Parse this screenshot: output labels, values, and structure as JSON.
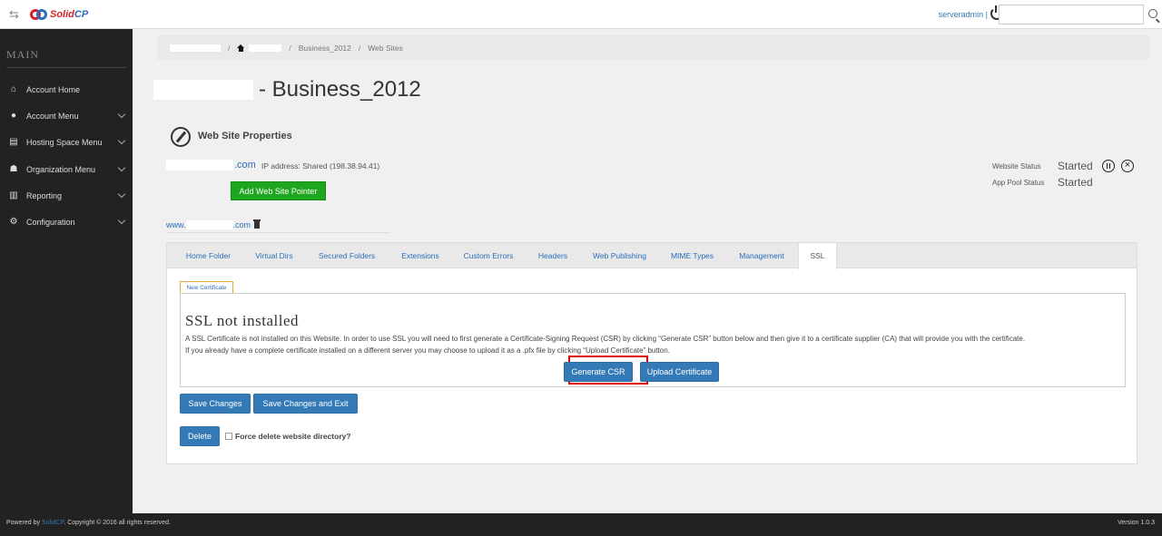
{
  "header": {
    "logo_solid": "Solid",
    "logo_cp": "CP",
    "user": "serveradmin |",
    "search_placeholder": ""
  },
  "sidebar": {
    "section_label": "MAIN",
    "items": [
      {
        "label": "Account Home",
        "icon": "home-icon"
      },
      {
        "label": "Account Menu",
        "icon": "user-icon"
      },
      {
        "label": "Hosting Space Menu",
        "icon": "server-icon"
      },
      {
        "label": "Organization Menu",
        "icon": "users-icon"
      },
      {
        "label": "Reporting",
        "icon": "bar-chart-icon"
      },
      {
        "label": "Configuration",
        "icon": "gears-icon"
      }
    ]
  },
  "breadcrumb": {
    "sep": "/",
    "items": [
      "Business_2012",
      "Web Sites"
    ]
  },
  "page": {
    "title": "- Business_2012",
    "section_title": "Web Site Properties",
    "domain_suffix": ".com",
    "ip_text": "IP address: Shared (198.38.94.41)",
    "add_pointer_label": "Add Web Site Pointer",
    "pointer_prefix": "www.",
    "pointer_suffix": ".com",
    "website_status_label": "Website Status",
    "website_status_value": "Started",
    "app_pool_status_label": "App Pool Status",
    "app_pool_status_value": "Started"
  },
  "tabs": [
    {
      "label": "Home Folder"
    },
    {
      "label": "Virtual Dirs"
    },
    {
      "label": "Secured Folders"
    },
    {
      "label": "Extensions"
    },
    {
      "label": "Custom Errors"
    },
    {
      "label": "Headers"
    },
    {
      "label": "Web Publishing"
    },
    {
      "label": "MIME Types"
    },
    {
      "label": "Management"
    },
    {
      "label": "SSL"
    }
  ],
  "ssl": {
    "subtab_label": "New Certificate",
    "heading": "SSL not installed",
    "desc_line1": "A SSL Certificate is not installed on this Website. In order to use SSL you will need to first generate a Certificate-Signing Request (CSR) by clicking “Generate CSR” button below and then give it to a certificate supplier (CA) that will provide you with the certificate.",
    "desc_line2": "If you already have a complete certificate installed on a different server you may choose to upload it as a .pfx file by clicking “Upload Certificate” button.",
    "generate_csr_label": "Generate CSR",
    "upload_cert_label": "Upload Certificate"
  },
  "actions": {
    "save_label": "Save Changes",
    "save_exit_label": "Save Changes and Exit",
    "delete_label": "Delete",
    "force_delete_label": "Force delete website directory?"
  },
  "footer": {
    "powered_prefix": "Powered by",
    "powered_link": "SolidCP",
    "copyright": ". Copyright © 2016 all rights reserved.",
    "version": "Version 1.0.3"
  },
  "colors": {
    "accent": "#337ab7",
    "green_button": "#1ea61e",
    "highlight": "#e00000",
    "sidebar_bg": "#222222"
  }
}
